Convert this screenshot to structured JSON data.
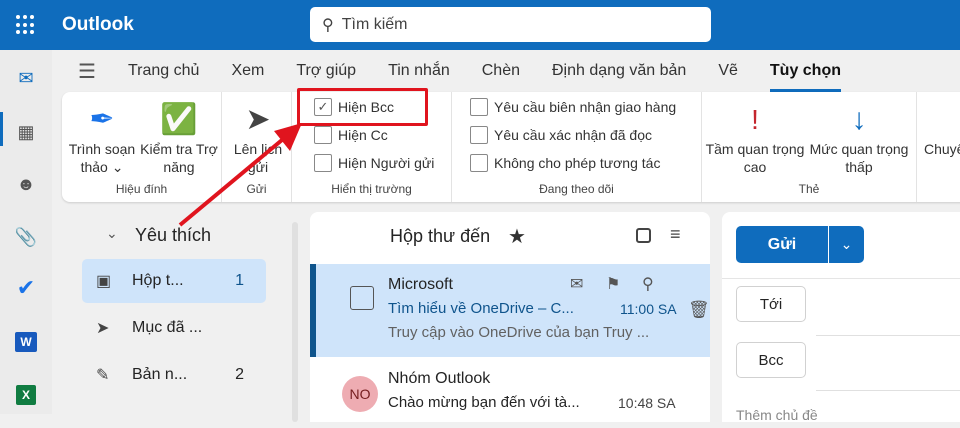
{
  "app": {
    "title": "Outlook",
    "search_placeholder": "Tìm kiếm"
  },
  "nav_tabs": [
    "Trang chủ",
    "Xem",
    "Trợ giúp",
    "Tin nhắn",
    "Chèn",
    "Định dạng văn bản",
    "Vẽ",
    "Tùy chọn"
  ],
  "active_tab": "Tùy chọn",
  "ribbon": {
    "proofing": {
      "label": "Hiệu đính",
      "editor": "Trình soạn thảo ⌄",
      "editor_l1": "Trình soạn",
      "editor_l2": "thảo ⌄",
      "access_l1": "Kiểm tra Trợ",
      "access_l2": "năng"
    },
    "send": {
      "label": "Gửi",
      "schedule_l1": "Lên lịch",
      "schedule_l2": "gửi"
    },
    "show_fields": {
      "label": "Hiển thị trường",
      "items": [
        {
          "label": "Hiện Bcc",
          "checked": true
        },
        {
          "label": "Hiện Cc",
          "checked": false
        },
        {
          "label": "Hiện Người gửi",
          "checked": false
        }
      ]
    },
    "tracking": {
      "label": "Đang theo dõi",
      "items": [
        {
          "label": "Yêu cầu biên nhận giao hàng",
          "checked": false
        },
        {
          "label": "Yêu cầu xác nhận đã đọc",
          "checked": false
        },
        {
          "label": "Không cho phép tương tác",
          "checked": false
        }
      ]
    },
    "tags": {
      "label": "Thẻ",
      "high_l1": "Tầm quan trọng",
      "high_l2": "cao",
      "low_l1": "Mức quan trọng",
      "low_l2": "thấp"
    },
    "more": "Chuyể"
  },
  "folders": {
    "favorites": "Yêu thích",
    "items": [
      {
        "label": "Hộp t...",
        "count": "1"
      },
      {
        "label": "Mục đã ...",
        "count": ""
      },
      {
        "label": "Bản n...",
        "count": "2"
      }
    ]
  },
  "list": {
    "title": "Hộp thư đến",
    "messages": [
      {
        "sender": "Microsoft",
        "subject": "Tìm hiểu về OneDrive – C...",
        "time": "11:00 SA",
        "preview": "Truy cập vào OneDrive của bạn Truy ..."
      },
      {
        "initials": "NO",
        "sender": "Nhóm Outlook",
        "subject": "Chào mừng bạn đến với tà...",
        "time": "10:48 SA"
      }
    ]
  },
  "compose": {
    "send": "Gửi",
    "to": "Tới",
    "bcc": "Bcc",
    "subject_placeholder": "Thêm chủ đề"
  },
  "colors": {
    "brand": "#0f6cbd",
    "highlight": "#e0141e",
    "selected": "#cfe4fa"
  }
}
